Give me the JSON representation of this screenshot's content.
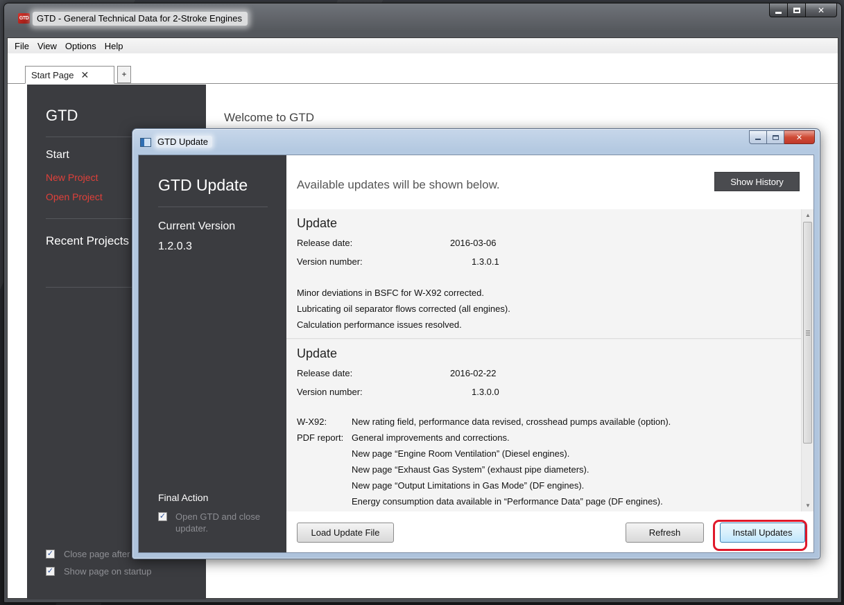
{
  "main_window": {
    "icon_text": "GTD",
    "title": "GTD - General Technical Data for 2-Stroke Engines",
    "menu": [
      "File",
      "View",
      "Options",
      "Help"
    ],
    "tab_label": "Start Page",
    "tab_close": "✕",
    "tab_add": "+"
  },
  "start_sidebar": {
    "title": "GTD",
    "start_heading": "Start",
    "new_project": "New Project",
    "open_project": "Open Project",
    "recent_projects": "Recent Projects",
    "close_page_after": "Close page after",
    "show_page_on_startup": "Show page on startup"
  },
  "start_page": {
    "welcome": "Welcome to GTD"
  },
  "dialog": {
    "title": "GTD Update",
    "sidebar": {
      "title": "GTD Update",
      "current_version_label": "Current Version",
      "current_version": "1.2.0.3",
      "final_action": "Final Action",
      "open_and_close": "Open GTD and close updater."
    },
    "header_text": "Available updates will be shown below.",
    "show_history": "Show History",
    "release_date_label": "Release date:",
    "version_number_label": "Version number:",
    "updates": [
      {
        "title": "Update",
        "release_date": "2016-03-06",
        "version": "1.3.0.1",
        "notes": [
          "Minor deviations in BSFC for W-X92 corrected.",
          "Lubricating oil separator flows corrected (all engines).",
          "Calculation performance issues resolved."
        ]
      },
      {
        "title": "Update",
        "release_date": "2016-02-22",
        "version": "1.3.0.0",
        "notes": [
          {
            "key": "W-X92:",
            "text": "New rating field, performance data revised, crosshead pumps available (option)."
          },
          {
            "key": "PDF report:",
            "text": "General improvements and corrections."
          },
          {
            "key": "",
            "text": "New page “Engine Room Ventilation” (Diesel engines)."
          },
          {
            "key": "",
            "text": "New page “Exhaust Gas System” (exhaust pipe diameters)."
          },
          {
            "key": "",
            "text": "New page “Output Limitations in Gas Mode” (DF engines)."
          },
          {
            "key": "",
            "text": "Energy consumption data available in “Performance Data” page (DF engines)."
          }
        ]
      }
    ],
    "buttons": {
      "load": "Load Update File",
      "refresh": "Refresh",
      "install": "Install Updates"
    }
  }
}
